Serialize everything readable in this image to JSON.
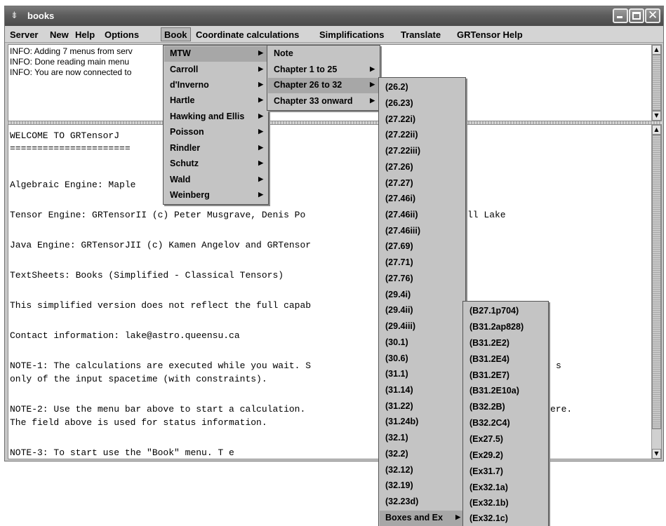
{
  "window": {
    "title": "books"
  },
  "menubar": [
    {
      "label": "Server"
    },
    {
      "label": "New"
    },
    {
      "label": "Help"
    },
    {
      "label": "Options"
    },
    {
      "label": "Book"
    },
    {
      "label": "Coordinate calculations"
    },
    {
      "label": "Simplifications"
    },
    {
      "label": "Translate"
    },
    {
      "label": "GRTensor Help"
    }
  ],
  "status_lines": [
    "INFO: Adding 7 menus from serv",
    "INFO: Done reading main menu",
    "INFO: You are now connected to"
  ],
  "main_lines": [
    "WELCOME TO GRTensorJ",
    "======================",
    "Algebraic Engine: Maple",
    "Tensor Engine: GRTensorII  (c) Peter Musgrave, Denis Po",
    "ll Lake",
    "Java Engine: GRTensorJII (c) Kamen Angelov and GRTensor",
    "TextSheets: Books (Simplified - Classical Tensors)",
    "This simplified version does not reflect the full capab",
    "Contact information: lake@astro.queensu.ca",
    "NOTE-1: The calculations are executed while you wait. S",
    "s",
    "only of the input spacetime (with constraints).",
    "NOTE-2: Use the menu bar above to start a calculation.",
    "ere.",
    "The field above is used for status information.",
    "NOTE-3: To start use the \"Book\" menu. T e"
  ],
  "book_menu": {
    "items": [
      "MTW",
      "Carroll",
      "d'Inverno",
      "Hartle",
      "Hawking and Ellis",
      "Poisson",
      "Rindler",
      "Schutz",
      "Wald",
      "Weinberg"
    ],
    "selected": "MTW"
  },
  "mtw_menu": {
    "items": [
      "Note",
      "Chapter 1 to 25",
      "Chapter 26 to 32",
      "Chapter 33 onward"
    ],
    "selected": "Chapter 26 to 32"
  },
  "chapter_menu": {
    "items": [
      "(26.2)",
      "(26.23)",
      "(27.22i)",
      "(27.22ii)",
      "(27.22iii)",
      "(27.26)",
      "(27.27)",
      "(27.46i)",
      "(27.46ii)",
      "(27.46iii)",
      "(27.69)",
      "(27.71)",
      "(27.76)",
      "(29.4i)",
      "(29.4ii)",
      "(29.4iii)",
      "(30.1)",
      "(30.6)",
      "(31.1)",
      "(31.14)",
      "(31.22)",
      "(31.24b)",
      "(32.1)",
      "(32.2)",
      "(32.12)",
      "(32.19)",
      "(32.23d)",
      "Boxes and Ex"
    ],
    "selected": "Boxes and Ex"
  },
  "boxes_menu": {
    "items": [
      "(B27.1p704)",
      "(B31.2ap828)",
      "(B31.2E2)",
      "(B31.2E4)",
      "(B31.2E7)",
      "(B31.2E10a)",
      "(B32.2B)",
      "(B32.2C4)",
      "(Ex27.5)",
      "(Ex29.2)",
      "(Ex31.7)",
      "(Ex32.1a)",
      "(Ex32.1b)",
      "(Ex32.1c)"
    ]
  },
  "icons": {
    "app": "app-icon",
    "minimize": "minimize-icon",
    "maximize": "maximize-icon",
    "close": "close-icon",
    "submenu": "submenu-arrow-icon"
  }
}
